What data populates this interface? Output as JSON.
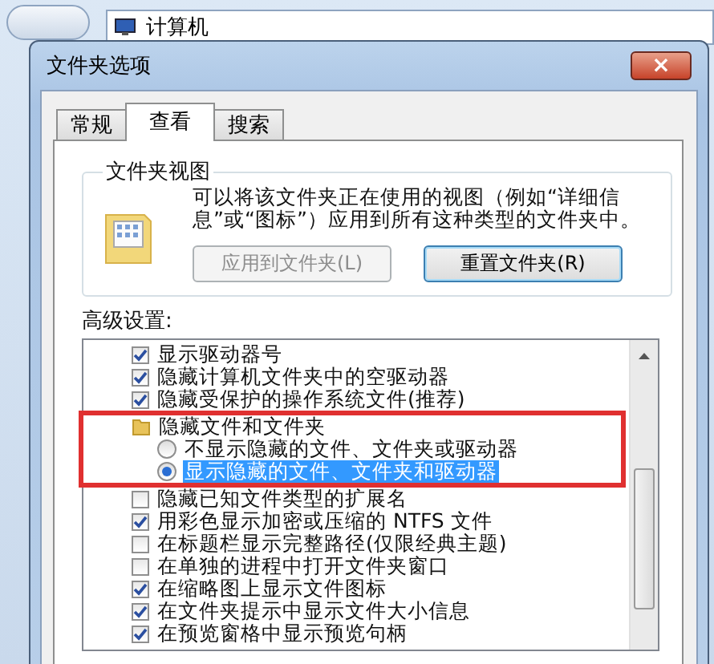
{
  "explorer": {
    "address": "计算机"
  },
  "window": {
    "title": "文件夹选项",
    "close": "×"
  },
  "tabs": [
    {
      "label": "常规",
      "selected": false
    },
    {
      "label": "查看",
      "selected": true
    },
    {
      "label": "搜索",
      "selected": false
    }
  ],
  "folder_views": {
    "title": "文件夹视图",
    "description": "可以将该文件夹正在使用的视图（例如“详细信息”或“图标”）应用到所有这种类型的文件夹中。",
    "buttons": [
      {
        "label": "应用到文件夹(L)",
        "disabled": true
      },
      {
        "label": "重置文件夹(R)",
        "disabled": false
      }
    ]
  },
  "advanced": {
    "label": "高级设置:",
    "items": [
      {
        "kind": "checkbox",
        "label": "显示驱动器号",
        "checked": true
      },
      {
        "kind": "checkbox",
        "label": "隐藏计算机文件夹中的空驱动器",
        "checked": true
      },
      {
        "kind": "checkbox",
        "label": "隐藏受保护的操作系统文件(推荐)",
        "checked": true
      },
      {
        "kind": "folder",
        "label": "隐藏文件和文件夹",
        "highlighted": true,
        "children": [
          {
            "kind": "radio",
            "label": "不显示隐藏的文件、文件夹或驱动器",
            "selected": false
          },
          {
            "kind": "radio",
            "label": "显示隐藏的文件、文件夹和驱动器",
            "selected": true
          }
        ]
      },
      {
        "kind": "checkbox",
        "label": "隐藏已知文件类型的扩展名",
        "checked": false
      },
      {
        "kind": "checkbox",
        "label": "用彩色显示加密或压缩的 NTFS 文件",
        "checked": true
      },
      {
        "kind": "checkbox",
        "label": "在标题栏显示完整路径(仅限经典主题)",
        "checked": false
      },
      {
        "kind": "checkbox",
        "label": "在单独的进程中打开文件夹窗口",
        "checked": false
      },
      {
        "kind": "checkbox",
        "label": "在缩略图上显示文件图标",
        "checked": true
      },
      {
        "kind": "checkbox",
        "label": "在文件夹提示中显示文件大小信息",
        "checked": true
      },
      {
        "kind": "checkbox",
        "label": "在预览窗格中显示预览句柄",
        "checked": true
      }
    ]
  }
}
